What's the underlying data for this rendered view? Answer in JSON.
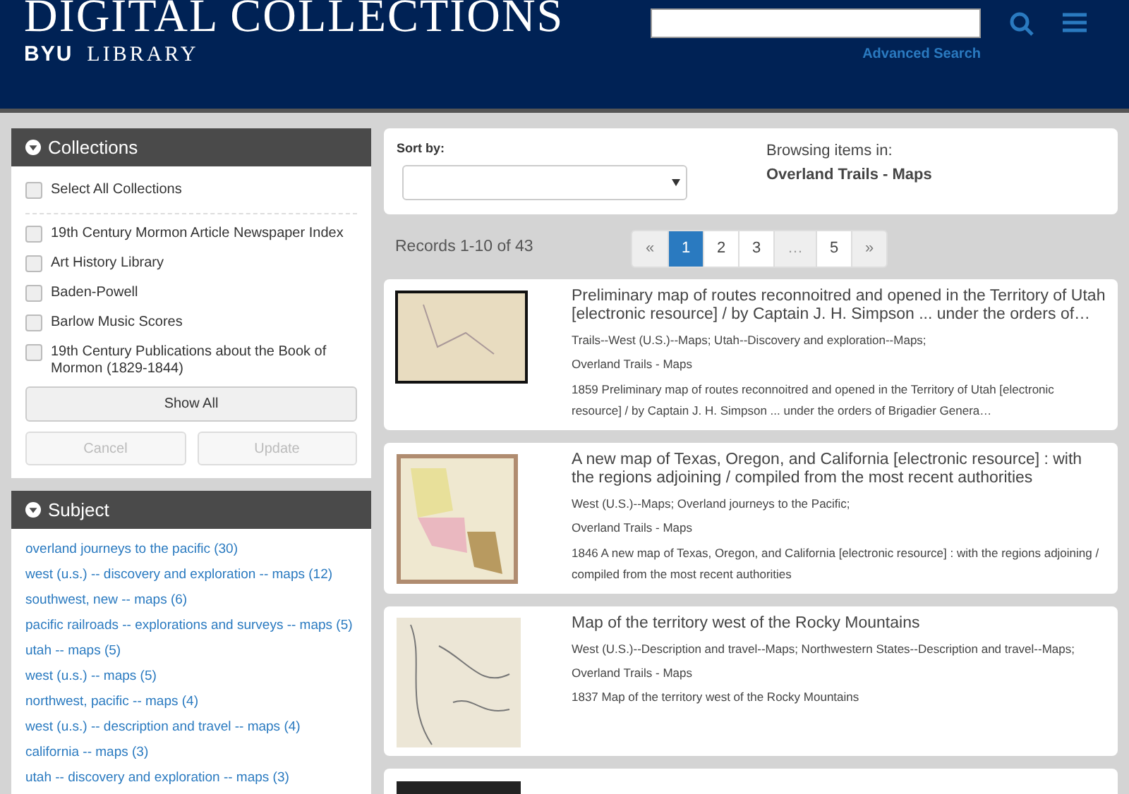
{
  "header": {
    "title": "DIGITAL COLLECTIONS",
    "subtitle_bold": "BYU",
    "subtitle": "LIBRARY",
    "advanced_link": "Advanced Search"
  },
  "collections": {
    "title": "Collections",
    "select_all": {
      "label": "Select All Collections",
      "checked": false
    },
    "items": [
      {
        "label": "19th Century Mormon Article Newspaper Index",
        "checked": false
      },
      {
        "label": "Art History Library",
        "checked": false
      },
      {
        "label": "Baden-Powell",
        "checked": false
      },
      {
        "label": "Barlow Music Scores",
        "checked": false
      },
      {
        "label": "19th Century Publications about the Book of Mormon (1829-1844)",
        "checked": false
      }
    ],
    "show_all": "Show All",
    "cancel": {
      "label": "Cancel",
      "disabled": true
    },
    "update": {
      "label": "Update",
      "disabled": true
    }
  },
  "subject": {
    "title": "Subject",
    "items": [
      "overland journeys to the pacific (30)",
      "west (u.s.) -- discovery and exploration -- maps (12)",
      "southwest, new -- maps (6)",
      "pacific railroads -- explorations and surveys -- maps (5)",
      "utah -- maps (5)",
      "west (u.s.) -- maps (5)",
      "northwest, pacific -- maps (4)",
      "west (u.s.) -- description and travel -- maps (4)",
      "california -- maps (3)",
      "utah -- discovery and exploration -- maps (3)"
    ]
  },
  "sort": {
    "label": "Sort by:"
  },
  "browsing": {
    "label": "Browsing items in:",
    "collection": "Overland Trails - Maps"
  },
  "records": "Records 1-10 of 43",
  "pagination": [
    {
      "label": "«",
      "kind": "nav",
      "selected": false
    },
    {
      "label": "1",
      "kind": "page",
      "selected": true
    },
    {
      "label": "2",
      "kind": "page",
      "selected": false
    },
    {
      "label": "3",
      "kind": "page",
      "selected": false
    },
    {
      "label": "…",
      "kind": "gap",
      "selected": false
    },
    {
      "label": "5",
      "kind": "page",
      "selected": false
    },
    {
      "label": "»",
      "kind": "nav",
      "selected": false
    }
  ],
  "results": [
    {
      "title": "Preliminary map of routes reconnoitred and opened in the Territory of Utah [electronic resource] / by Captain J. H. Simpson ... under the orders of…",
      "subjects": "Trails--West (U.S.)--Maps; Utah--Discovery and exploration--Maps;",
      "collection": "Overland Trails - Maps",
      "description": "1859 Preliminary map of routes reconnoitred and opened in the Territory of Utah [electronic resource] / by Captain J. H. Simpson ... under the orders of Brigadier Genera…"
    },
    {
      "title": "A new map of Texas, Oregon, and California [electronic resource] : with the regions adjoining / compiled from the most recent authorities",
      "subjects": "West (U.S.)--Maps; Overland journeys to the Pacific;",
      "collection": "Overland Trails - Maps",
      "description": "1846 A new map of Texas, Oregon, and California [electronic resource] : with the regions adjoining / compiled from the most recent authorities"
    },
    {
      "title": "Map of the territory west of the Rocky Mountains",
      "subjects": "West (U.S.)--Description and travel--Maps; Northwestern States--Description and travel--Maps;",
      "collection": "Overland Trails - Maps",
      "description": "1837 Map of the territory west of the Rocky Mountains"
    }
  ]
}
